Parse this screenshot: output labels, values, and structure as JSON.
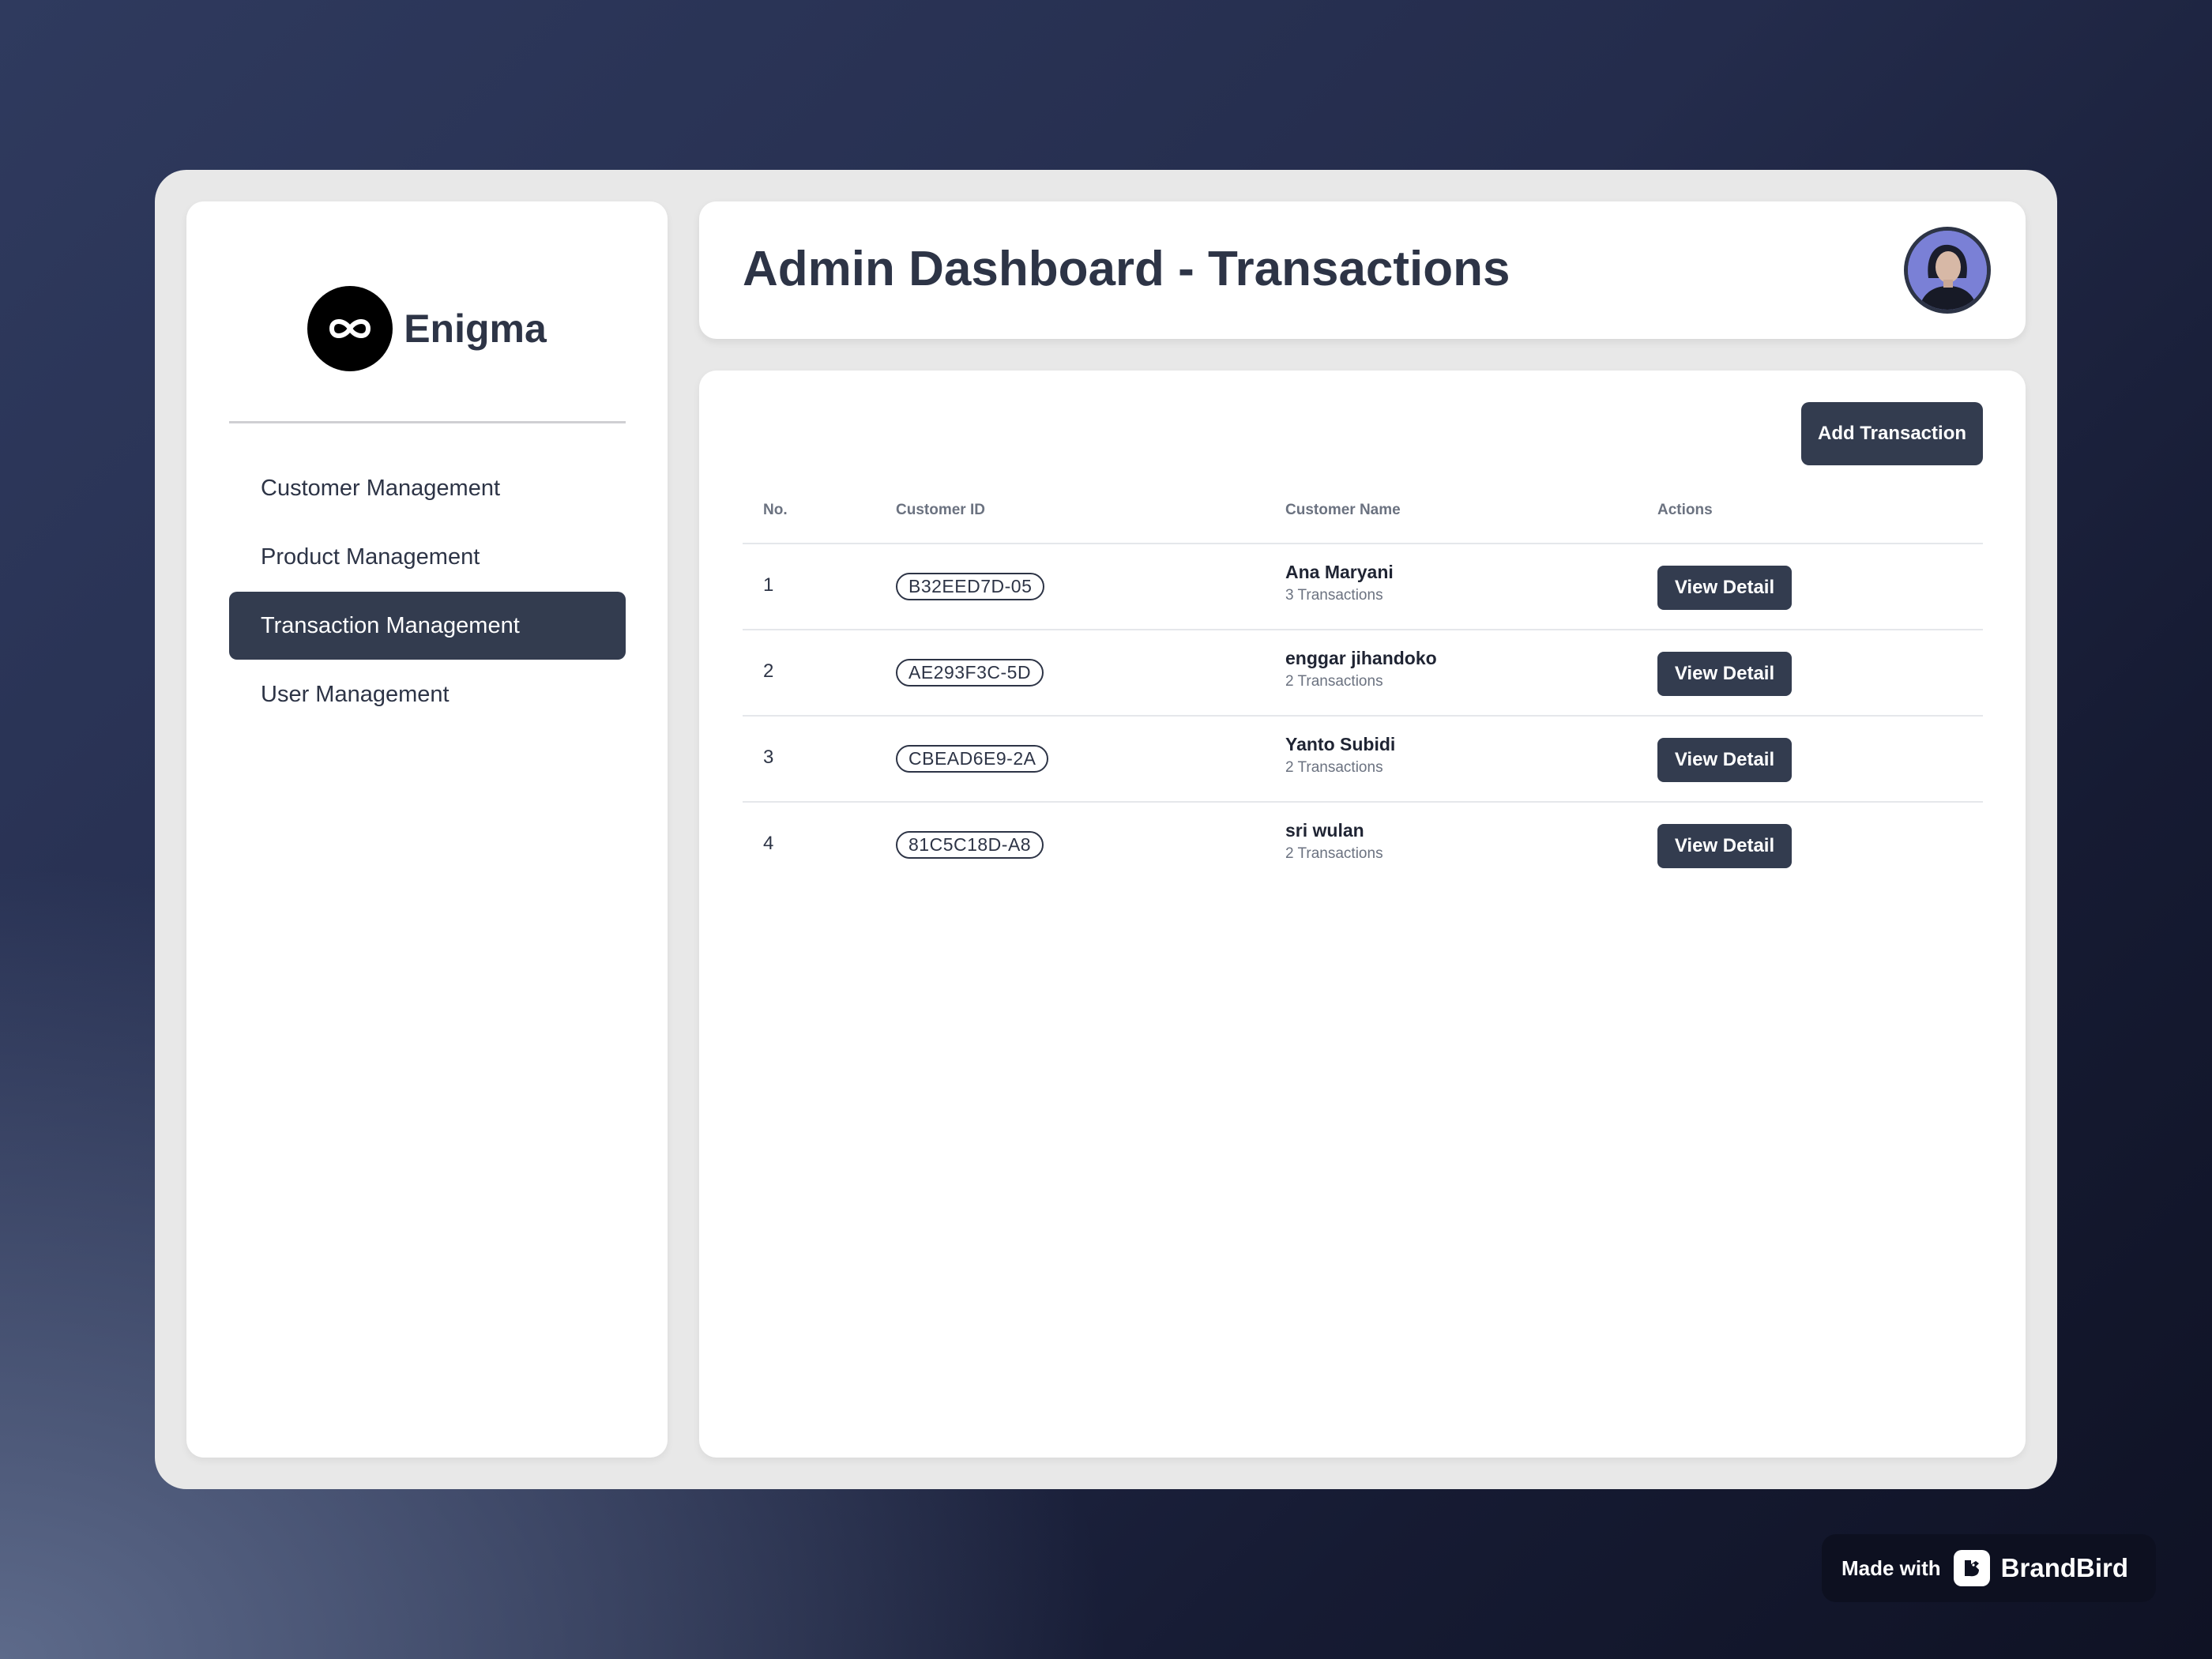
{
  "sidebar": {
    "brand": "Enigma",
    "items": [
      {
        "label": "Customer Management",
        "active": false
      },
      {
        "label": "Product Management",
        "active": false
      },
      {
        "label": "Transaction Management",
        "active": true
      },
      {
        "label": "User Management",
        "active": false
      }
    ]
  },
  "header": {
    "title": "Admin Dashboard - Transactions"
  },
  "panel": {
    "add_label": "Add Transaction",
    "columns": [
      "No.",
      "Customer ID",
      "Customer Name",
      "Actions"
    ],
    "rows": [
      {
        "no": "1",
        "id": "B32EED7D-05",
        "name": "Ana Maryani",
        "count": "3 Transactions",
        "action": "View Detail"
      },
      {
        "no": "2",
        "id": "AE293F3C-5D",
        "name": "enggar jihandoko",
        "count": "2 Transactions",
        "action": "View Detail"
      },
      {
        "no": "3",
        "id": "CBEAD6E9-2A",
        "name": "Yanto Subidi",
        "count": "2 Transactions",
        "action": "View Detail"
      },
      {
        "no": "4",
        "id": "81C5C18D-A8",
        "name": "sri wulan",
        "count": "2 Transactions",
        "action": "View Detail"
      }
    ]
  },
  "watermark": {
    "made_with": "Made with",
    "brand": "BrandBird"
  },
  "colors": {
    "dark_accent": "#333c4f",
    "text": "#2d3446",
    "frame": "#e8e8e8",
    "avatar_bg": "#7a80d6"
  }
}
